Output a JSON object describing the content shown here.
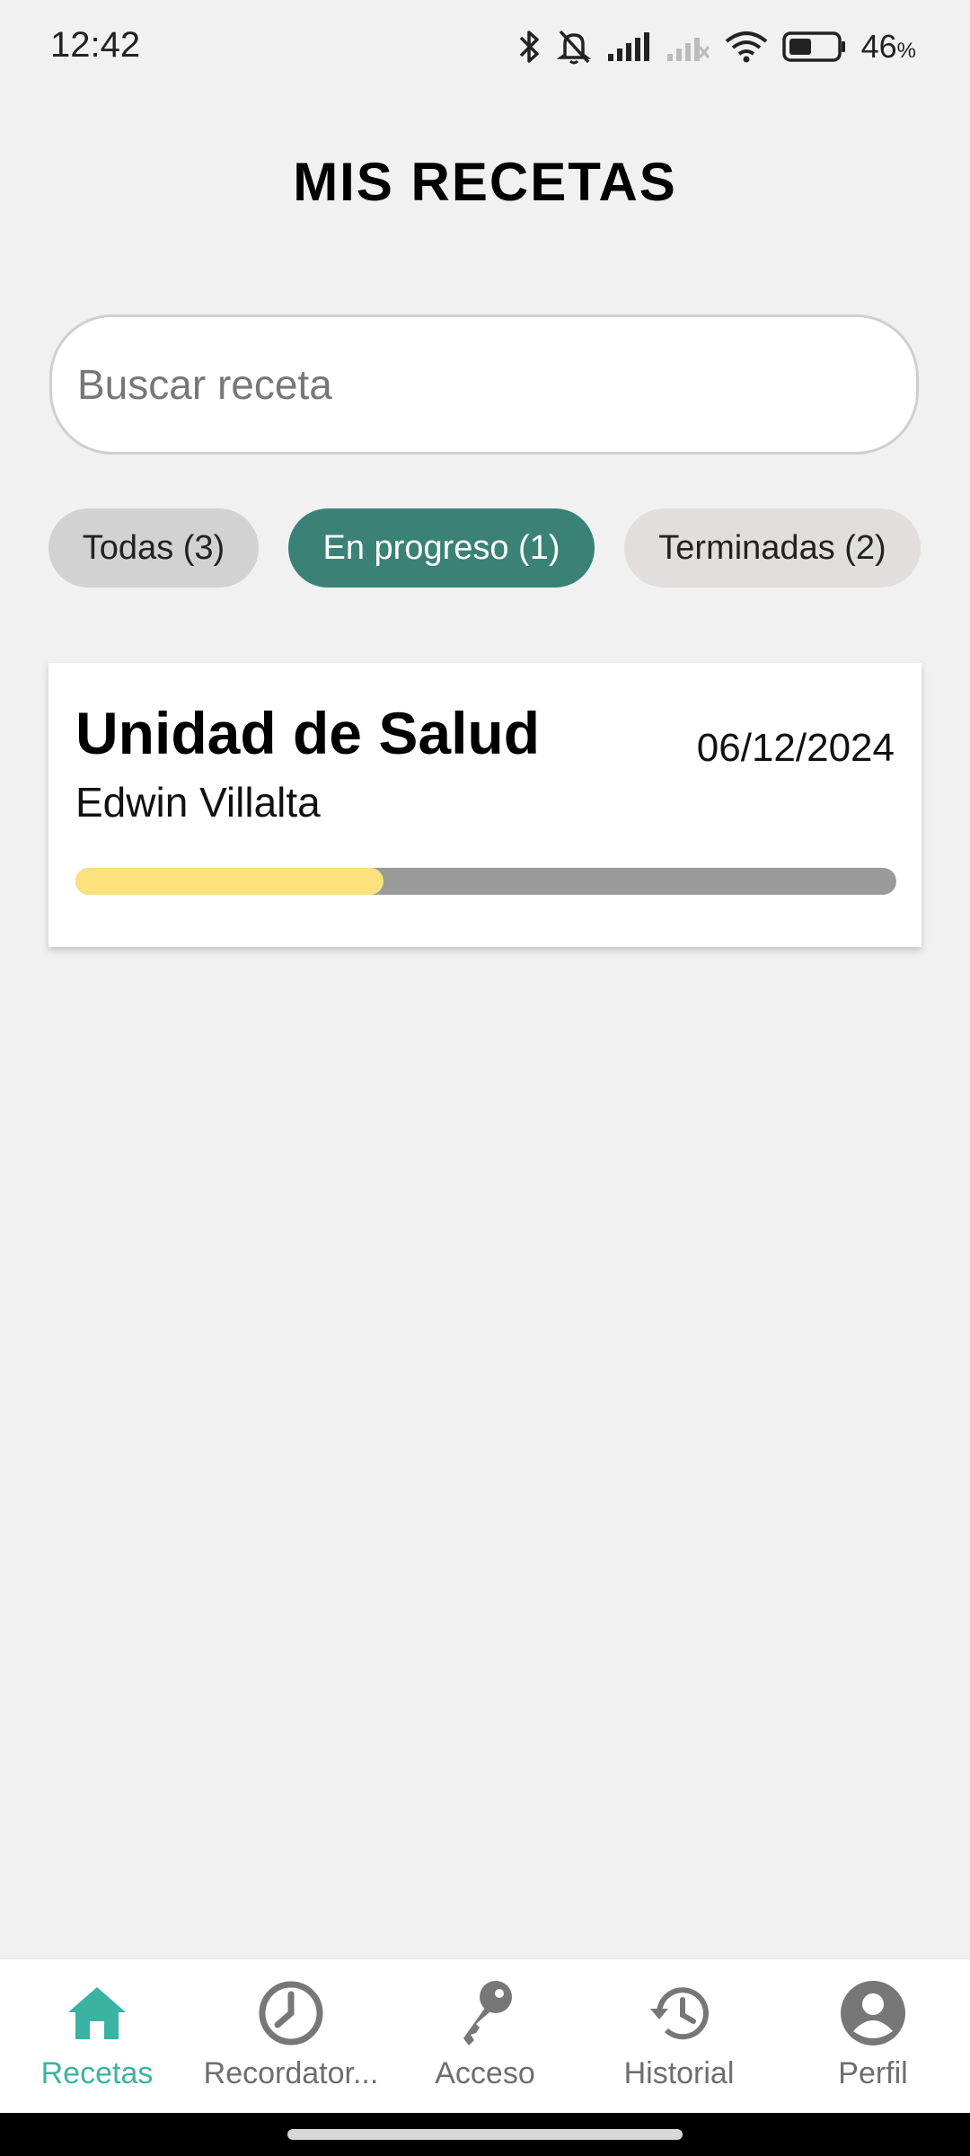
{
  "status_bar": {
    "time": "12:42",
    "battery_percent": "46",
    "battery_unit": "%",
    "icons": [
      "bluetooth-icon",
      "bell-off-icon",
      "signal-icon",
      "signal-x-icon",
      "wifi-icon",
      "battery-icon"
    ]
  },
  "header": {
    "title": "MIS RECETAS"
  },
  "search": {
    "placeholder": "Buscar receta",
    "value": ""
  },
  "filters": [
    {
      "label": "Todas (3)",
      "active": false
    },
    {
      "label": "En progreso (1)",
      "active": true
    },
    {
      "label": "Terminadas (2)",
      "active": false
    }
  ],
  "recipes": [
    {
      "title": "Unidad de Salud",
      "doctor": "Edwin Villalta",
      "date": "06/12/2024",
      "progress": 0.375
    }
  ],
  "bottom_nav": [
    {
      "label": "Recetas",
      "icon": "home-icon",
      "active": true
    },
    {
      "label": "Recordator...",
      "icon": "clock-icon",
      "active": false
    },
    {
      "label": "Acceso",
      "icon": "key-icon",
      "active": false
    },
    {
      "label": "Historial",
      "icon": "history-icon",
      "active": false
    },
    {
      "label": "Perfil",
      "icon": "profile-icon",
      "active": false
    }
  ],
  "colors": {
    "accent": "#3a8276",
    "nav_active": "#3bb3a3",
    "progress_fill": "#fbe27d",
    "progress_track": "#9a9a9a"
  }
}
